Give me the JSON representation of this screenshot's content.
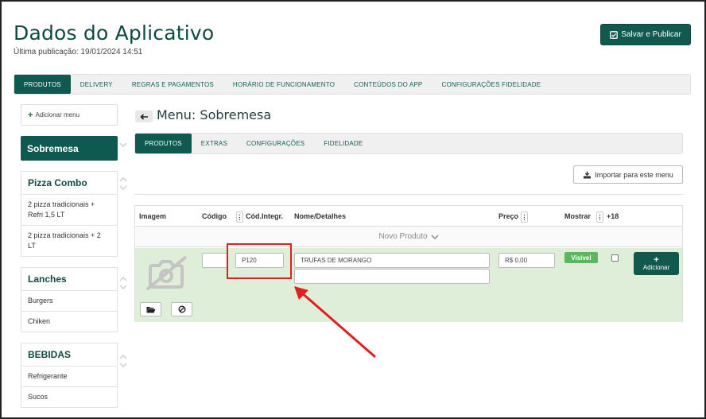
{
  "header": {
    "title": "Dados do Aplicativo",
    "last_published": "Última publicação: 19/01/2024 14:51",
    "save_label": "Salvar e Publicar"
  },
  "main_tabs": [
    {
      "label": "PRODUTOS",
      "active": true
    },
    {
      "label": "DELIVERY"
    },
    {
      "label": "REGRAS E PAGAMENTOS"
    },
    {
      "label": "HORÁRIO DE FUNCIONAMENTO"
    },
    {
      "label": "CONTEÚDOS DO APP"
    },
    {
      "label": "CONFIGURAÇÕES FIDELIDADE"
    }
  ],
  "sidebar": {
    "add_menu_label": "Adicionar menu",
    "active_menu": "Sobremesa",
    "groups": [
      {
        "title": "Pizza Combo",
        "items": [
          "2 pizza tradicionais + Refri 1,5 LT",
          "2 pizza tradicionais + 2 LT"
        ]
      },
      {
        "title": "Lanches",
        "items": [
          "Burgers",
          "Chiken"
        ]
      },
      {
        "title": "BEBIDAS",
        "items": [
          "Refrigerante",
          "Sucos"
        ]
      }
    ]
  },
  "menu": {
    "title": "Menu: Sobremesa",
    "tabs": [
      {
        "label": "PRODUTOS",
        "active": true
      },
      {
        "label": "EXTRAS"
      },
      {
        "label": "CONFIGURAÇÕES"
      },
      {
        "label": "FIDELIDADE"
      }
    ],
    "import_label": "Importar para este menu"
  },
  "table": {
    "headers": {
      "image": "Imagem",
      "code": "Código",
      "integration_code": "Cód.Integr.",
      "name": "Nome/Detalhes",
      "price": "Preço",
      "show": "Mostrar",
      "age": "+18"
    },
    "new_product_label": "Novo Produto",
    "row": {
      "code_value": "",
      "integration_code_value": "P120",
      "name_value": "TRUFAS DE MORANGO",
      "details_value": "",
      "price_value": "R$ 0,00",
      "visible_badge": "Visível",
      "age_checked": false,
      "add_label": "Adicionar"
    }
  },
  "colors": {
    "primary": "#0f5a50",
    "row_background": "#dfeed8",
    "visible_badge": "#5cb85c",
    "highlight": "#e02020"
  }
}
